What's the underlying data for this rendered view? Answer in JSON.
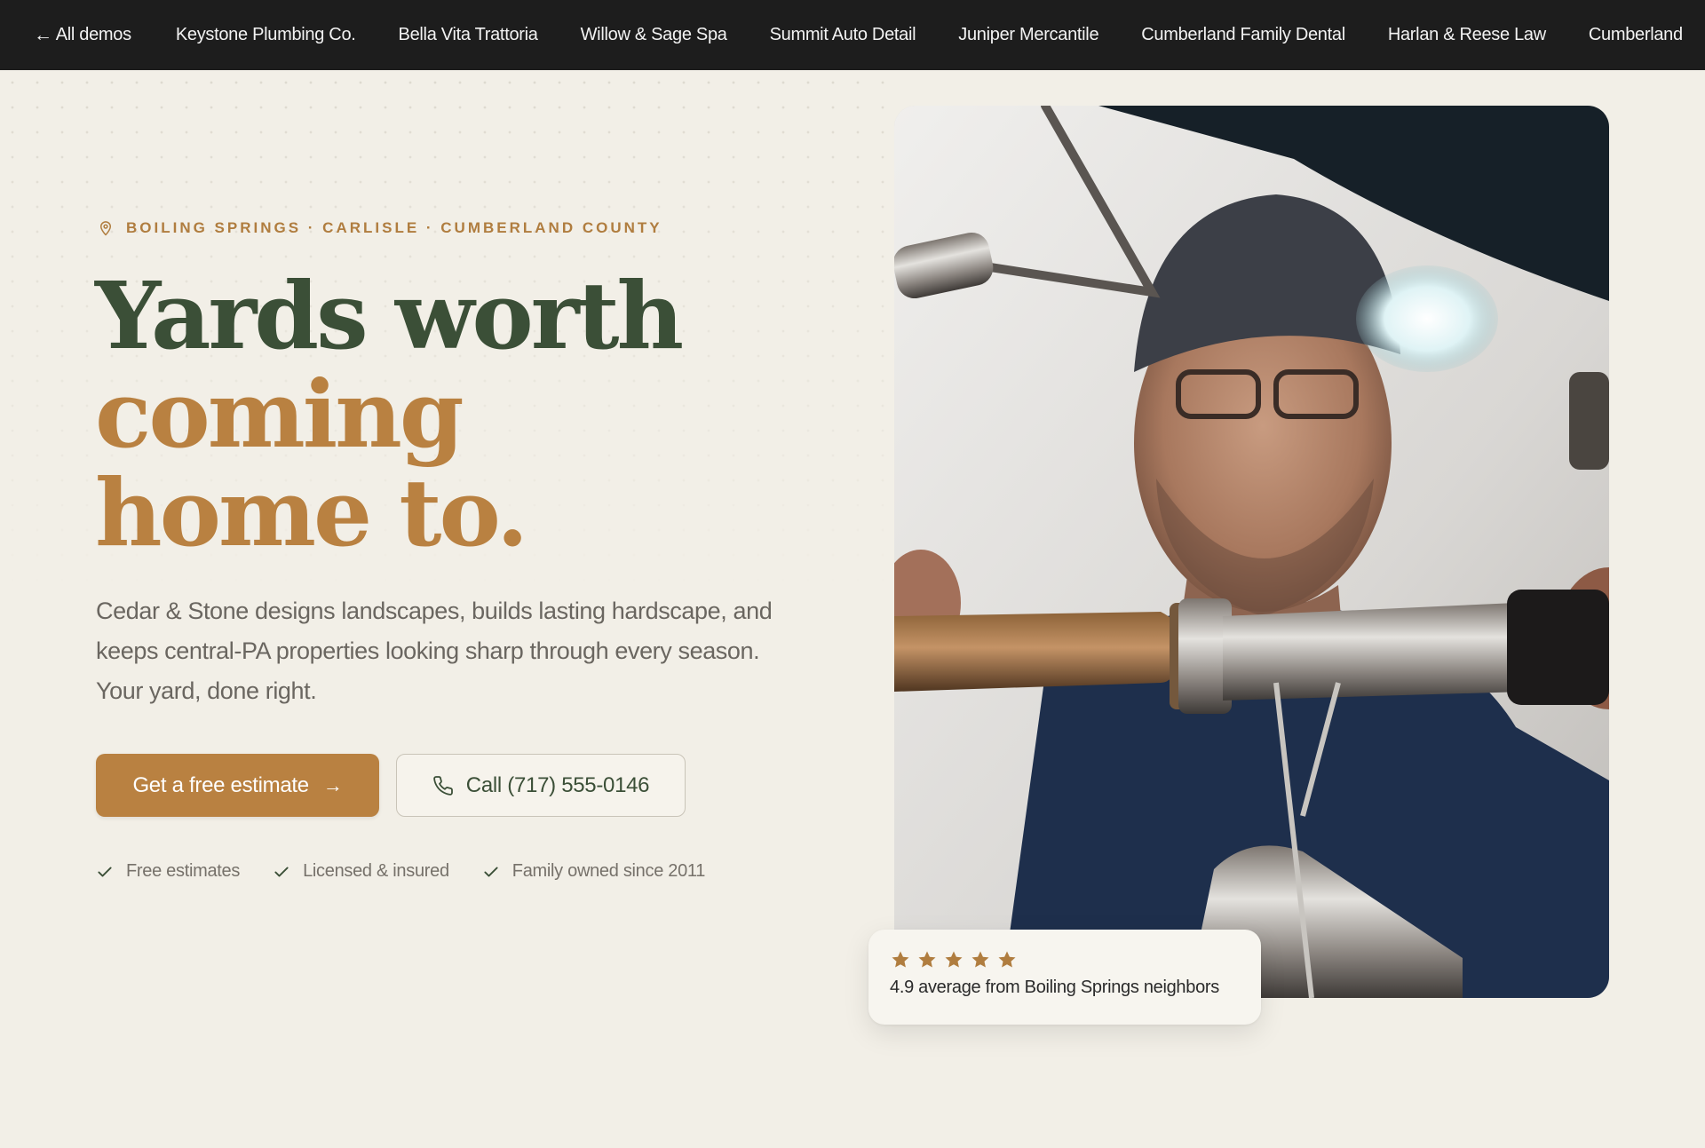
{
  "nav": {
    "back_label": "All demos",
    "items": [
      "Keystone Plumbing Co.",
      "Bella Vita Trattoria",
      "Willow & Sage Spa",
      "Summit Auto Detail",
      "Juniper Mercantile",
      "Cumberland Family Dental",
      "Harlan & Reese Law",
      "Cumberland"
    ]
  },
  "hero": {
    "eyebrow": "BOILING SPRINGS · CARLISLE · CUMBERLAND COUNTY",
    "headline_line1": "Yards worth",
    "headline_line2": "coming",
    "headline_line3": "home to.",
    "lead": "Cedar & Stone designs landscapes, builds lasting hardscape, and keeps central-PA properties looking sharp through every season. Your yard, done right.",
    "cta_primary": "Get a free estimate",
    "cta_secondary": "Call (717) 555-0146",
    "trust": [
      "Free estimates",
      "Licensed & insured",
      "Family owned since 2011"
    ]
  },
  "review": {
    "rating_stars": 5,
    "text": "4.9 average from Boiling Springs neighbors"
  },
  "colors": {
    "background": "#f2efe7",
    "nav_bg": "#1d1d1d",
    "accent_gold": "#b98141",
    "forest_green": "#3b4f37",
    "body_text": "#6a6660"
  },
  "icons": {
    "back": "arrow-left-icon",
    "eyebrow": "map-pin-icon",
    "cta_primary": "arrow-right-icon",
    "cta_secondary": "phone-icon",
    "trust": "check-icon",
    "rating": "star-icon"
  }
}
